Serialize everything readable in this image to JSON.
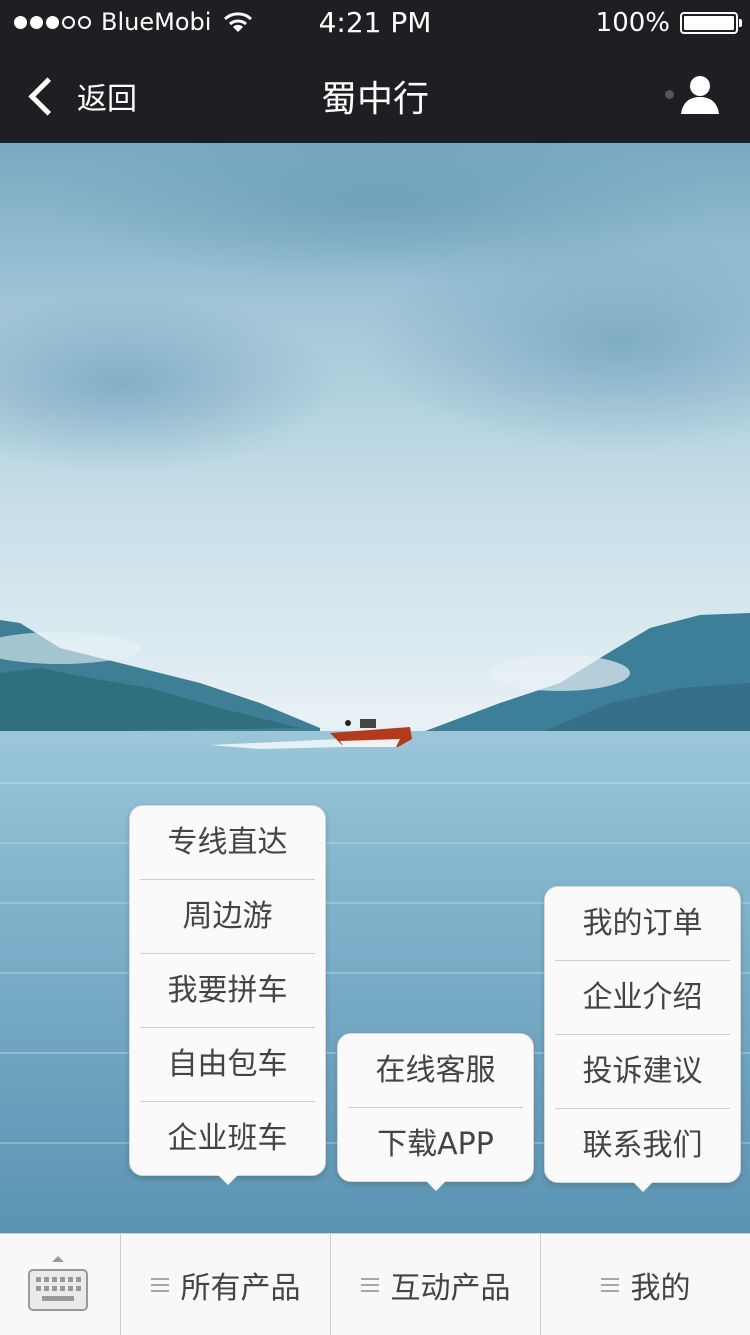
{
  "status_bar": {
    "carrier": "BlueMobi",
    "time": "4:21 PM",
    "battery": "100%",
    "signal_bars_filled": 3,
    "signal_bars_total": 5
  },
  "nav": {
    "back_label": "返回",
    "title": "蜀中行",
    "profile_icon": "user-icon"
  },
  "menus": {
    "all_products": [
      "专线直达",
      "周边游",
      "我要拼车",
      "自由包车",
      "企业班车"
    ],
    "interactive_products": [
      "在线客服",
      "下载APP"
    ],
    "mine": [
      "我的订单",
      "企业介绍",
      "投诉建议",
      "联系我们"
    ]
  },
  "tabbar": {
    "keyboard_icon": "keyboard-icon",
    "tabs": [
      "所有产品",
      "互动产品",
      "我的"
    ]
  },
  "colors": {
    "bar_dark": "#1f1f23",
    "tab_bg": "#f8f8f8",
    "menu_text": "#444444"
  }
}
